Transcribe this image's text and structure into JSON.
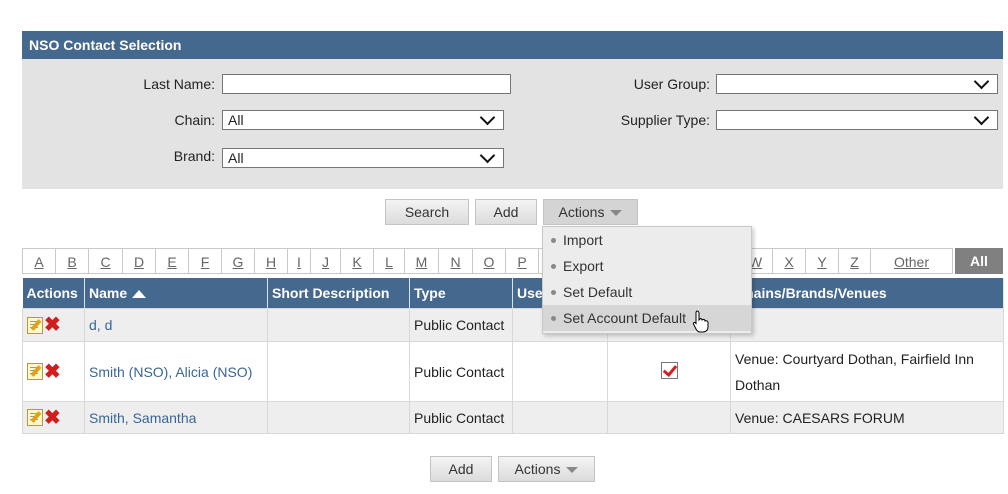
{
  "panel": {
    "title": "NSO Contact Selection"
  },
  "form": {
    "last_name_label": "Last Name:",
    "last_name_value": "",
    "chain_label": "Chain:",
    "chain_value": "All",
    "brand_label": "Brand:",
    "brand_value": "All",
    "user_group_label": "User Group:",
    "user_group_value": "",
    "supplier_type_label": "Supplier Type:",
    "supplier_type_value": ""
  },
  "toolbar": {
    "search": "Search",
    "add": "Add",
    "actions": "Actions"
  },
  "actions_menu": {
    "items": [
      "Import",
      "Export",
      "Set Default",
      "Set Account Default"
    ]
  },
  "alphabet": [
    "A",
    "B",
    "C",
    "D",
    "E",
    "F",
    "G",
    "H",
    "I",
    "J",
    "K",
    "L",
    "M",
    "N",
    "O",
    "P",
    "W",
    "X",
    "Y",
    "Z",
    "Other",
    "All"
  ],
  "table": {
    "headers": [
      "Actions",
      "Name",
      "Short Description",
      "Type",
      "Use",
      "",
      "Chains/Brands/Venues"
    ],
    "rows": [
      {
        "name": "d, d",
        "short_description": "",
        "type": "Public Contact",
        "user": "",
        "default": false,
        "venues": ""
      },
      {
        "name": "Smith (NSO), Alicia (NSO)",
        "short_description": "",
        "type": "Public Contact",
        "user": "",
        "default": true,
        "venues": "Venue: Courtyard Dothan, Fairfield Inn Dothan"
      },
      {
        "name": "Smith, Samantha",
        "short_description": "",
        "type": "Public Contact",
        "user": "",
        "default": false,
        "venues": "Venue: CAESARS FORUM"
      }
    ]
  },
  "footer": {
    "add": "Add",
    "actions": "Actions"
  },
  "colors": {
    "header_blue": "#45688e",
    "link_blue": "#3a6696",
    "panel_gray": "#e3e3e3",
    "delete_red": "#d21d1d"
  }
}
